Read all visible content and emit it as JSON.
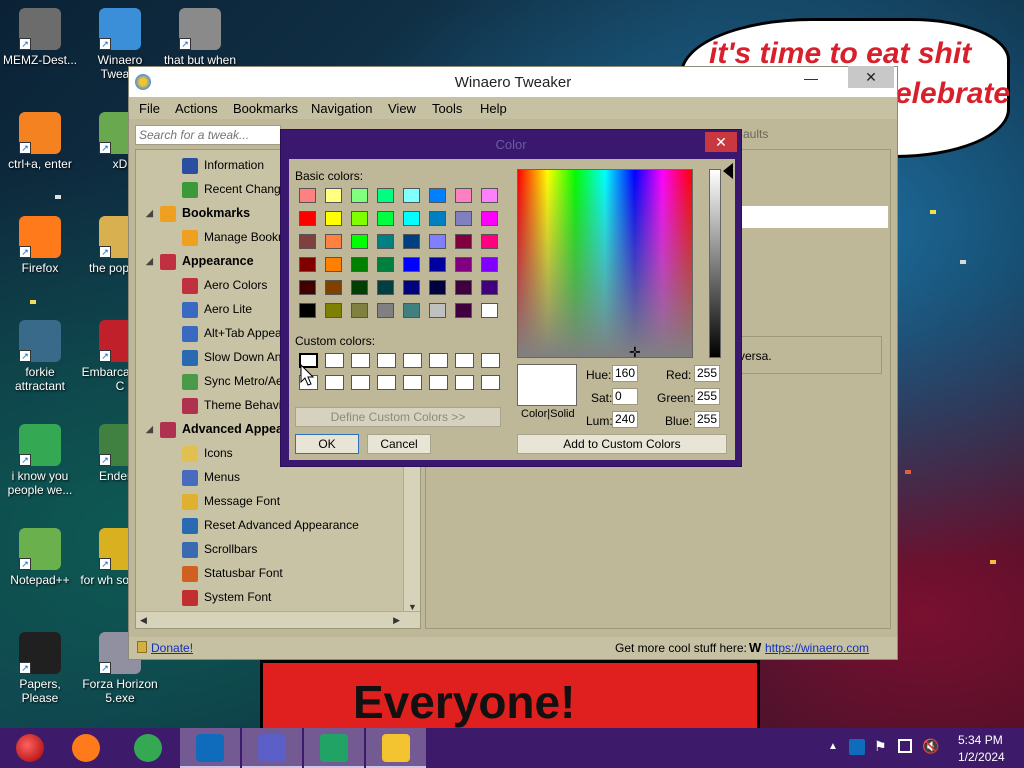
{
  "desktop": {
    "icons": [
      {
        "label": "MEMZ-Dest..."
      },
      {
        "label": "Winaero Twea..."
      },
      {
        "label": "that but when"
      },
      {
        "label": "ctrl+a, enter"
      },
      {
        "label": "xD"
      },
      {
        "label": "Firefox"
      },
      {
        "label": "the pop shit"
      },
      {
        "label": "forkie attractant"
      },
      {
        "label": "Embarca Dev-C"
      },
      {
        "label": "i know you people we..."
      },
      {
        "label": "Enderm"
      },
      {
        "label": "Notepad++"
      },
      {
        "label": "for wh some ru"
      },
      {
        "label": "Papers, Please"
      },
      {
        "label": "Forza Horizon 5.exe"
      }
    ],
    "bubble_line1": "it's time to eat shit",
    "bubble_line2": "elebrate",
    "banner_text": "Everyone!"
  },
  "window": {
    "title": "Winaero Tweaker",
    "minimize": "—",
    "maximize": "☐",
    "close": "✕",
    "menu": [
      "File",
      "Actions",
      "Bookmarks",
      "Navigation",
      "View",
      "Tools",
      "Help"
    ],
    "search_placeholder": "Search for a tweak...",
    "right_hint": "aults",
    "right_text": "versa.",
    "tree": [
      {
        "label": "Information",
        "cat": false
      },
      {
        "label": "Recent Changes",
        "cat": false
      },
      {
        "label": "Bookmarks",
        "cat": true
      },
      {
        "label": "Manage Bookmarks",
        "cat": false
      },
      {
        "label": "Appearance",
        "cat": true
      },
      {
        "label": "Aero Colors",
        "cat": false
      },
      {
        "label": "Aero Lite",
        "cat": false
      },
      {
        "label": "Alt+Tab Appearance",
        "cat": false
      },
      {
        "label": "Slow Down Animations",
        "cat": false
      },
      {
        "label": "Sync Metro/Aero Colors",
        "cat": false
      },
      {
        "label": "Theme Behavior",
        "cat": false
      },
      {
        "label": "Advanced Appearance",
        "cat": true
      },
      {
        "label": "Icons",
        "cat": false
      },
      {
        "label": "Menus",
        "cat": false
      },
      {
        "label": "Message Font",
        "cat": false
      },
      {
        "label": "Reset Advanced Appearance",
        "cat": false
      },
      {
        "label": "Scrollbars",
        "cat": false
      },
      {
        "label": "Statusbar Font",
        "cat": false
      },
      {
        "label": "System Font",
        "cat": false
      }
    ],
    "status_donate": "Donate!",
    "status_text": "Get more cool stuff here:",
    "status_link": "https://winaero.com"
  },
  "color_dialog": {
    "title": "Color",
    "close": "✕",
    "basic_label": "Basic colors:",
    "custom_label": "Custom colors:",
    "basic_colors": [
      "#ff8080",
      "#ffff80",
      "#80ff80",
      "#00ff80",
      "#80ffff",
      "#0080ff",
      "#ff80c0",
      "#ff80ff",
      "#ff0000",
      "#ffff00",
      "#80ff00",
      "#00ff40",
      "#00ffff",
      "#0080c0",
      "#8080c0",
      "#ff00ff",
      "#804040",
      "#ff8040",
      "#00ff00",
      "#008080",
      "#004080",
      "#8080ff",
      "#800040",
      "#ff0080",
      "#800000",
      "#ff8000",
      "#008000",
      "#008040",
      "#0000ff",
      "#0000a0",
      "#800080",
      "#8000ff",
      "#400000",
      "#804000",
      "#004000",
      "#004040",
      "#000080",
      "#000040",
      "#400040",
      "#400080",
      "#000000",
      "#808000",
      "#808040",
      "#808080",
      "#408080",
      "#c0c0c0",
      "#400040",
      "#ffffff"
    ],
    "define_custom": "Define Custom Colors >>",
    "ok": "OK",
    "cancel": "Cancel",
    "color_solid": "Color|Solid",
    "hue_label": "Hue:",
    "hue": "160",
    "sat_label": "Sat:",
    "sat": "0",
    "lum_label": "Lum:",
    "lum": "240",
    "red_label": "Red:",
    "red": "255",
    "green_label": "Green:",
    "green": "255",
    "blue_label": "Blue:",
    "blue": "255",
    "add_custom": "Add to Custom Colors"
  },
  "taskbar": {
    "apps": [
      {
        "name": "firefox-icon",
        "color": "#ff7a1a"
      },
      {
        "name": "chrome-icon",
        "color": "#34a853"
      },
      {
        "name": "outlook-icon",
        "color": "#0f6cbd"
      },
      {
        "name": "settings-icon",
        "color": "#5b5fc7"
      },
      {
        "name": "excel-icon",
        "color": "#21a366"
      },
      {
        "name": "winaero-icon",
        "color": "#f4c430"
      }
    ],
    "time": "5:34 PM",
    "date": "1/2/2024"
  }
}
